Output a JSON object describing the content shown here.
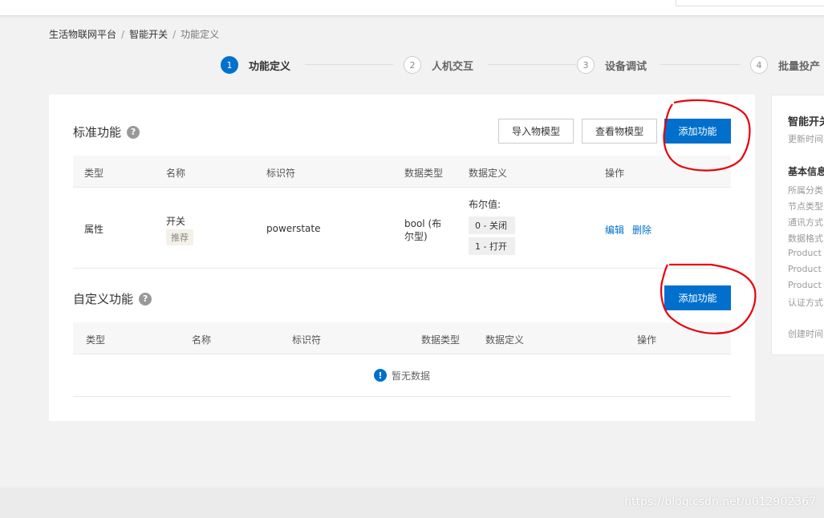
{
  "breadcrumb": {
    "root": "生活物联网平台",
    "product": "智能开关",
    "current": "功能定义"
  },
  "steps": [
    {
      "num": "1",
      "label": "功能定义",
      "active": true
    },
    {
      "num": "2",
      "label": "人机交互",
      "active": false
    },
    {
      "num": "3",
      "label": "设备调试",
      "active": false
    },
    {
      "num": "4",
      "label": "批量投产",
      "active": false
    }
  ],
  "standard": {
    "title": "标准功能",
    "import_btn": "导入物模型",
    "view_btn": "查看物模型",
    "add_btn": "添加功能",
    "columns": {
      "type": "类型",
      "name": "名称",
      "identifier": "标识符",
      "datatype": "数据类型",
      "datadef": "数据定义",
      "ops": "操作"
    },
    "rows": [
      {
        "type": "属性",
        "name": "开关",
        "tag": "推荐",
        "identifier": "powerstate",
        "datatype_line1": "bool (布",
        "datatype_line2": "尔型)",
        "datadef_label": "布尔值:",
        "enum0": "0 - 关闭",
        "enum1": "1 - 打开",
        "edit": "编辑",
        "delete": "删除"
      }
    ]
  },
  "custom": {
    "title": "自定义功能",
    "add_btn": "添加功能",
    "columns": {
      "type": "类型",
      "name": "名称",
      "identifier": "标识符",
      "datatype": "数据类型",
      "datadef": "数据定义",
      "ops": "操作"
    },
    "empty": "暂无数据"
  },
  "side": {
    "title": "智能开关",
    "subtitle": "更新时间",
    "section": "基本信息",
    "items": [
      "所属分类",
      "节点类型",
      "通讯方式",
      "数据格式",
      "Product",
      "Product",
      "Product",
      "认证方式"
    ],
    "created": "创建时间"
  },
  "watermark": "https://blog.csdn.net/u012902367",
  "colors": {
    "primary": "#0070cc",
    "annotation": "#e8000b"
  },
  "icons": {
    "help": "question-circle-icon",
    "info": "exclamation-circle-icon"
  }
}
